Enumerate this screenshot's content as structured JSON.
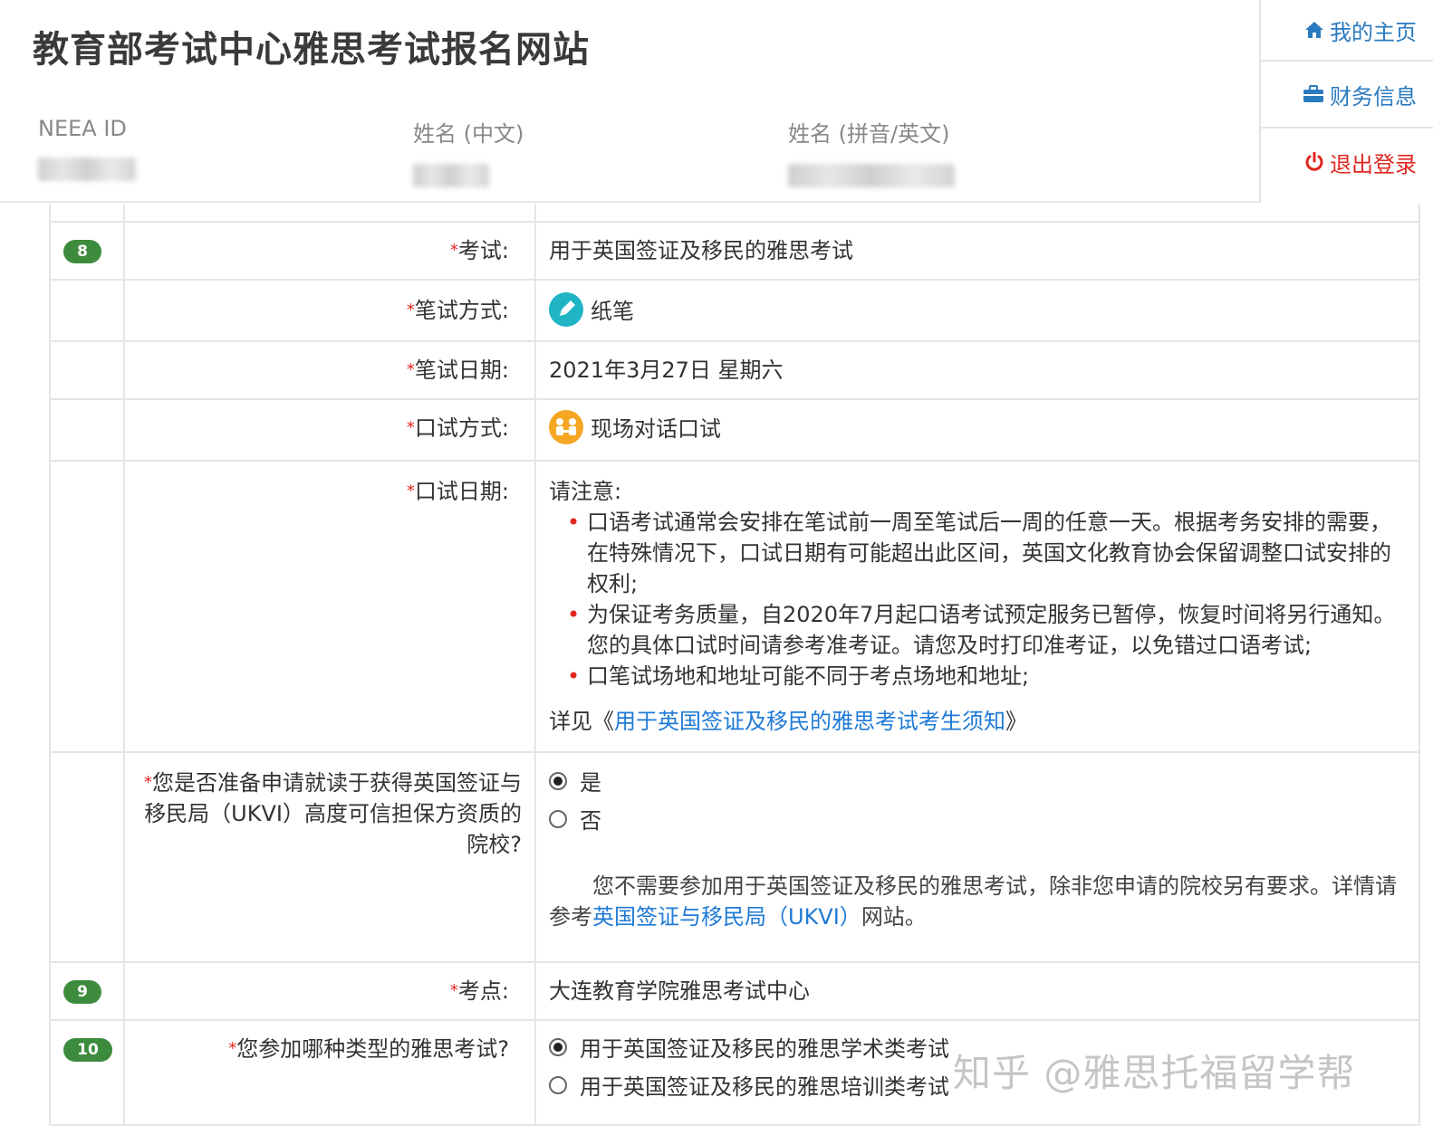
{
  "header": {
    "site_title": "教育部考试中心雅思考试报名网站",
    "fields": [
      {
        "label": "NEEA ID"
      },
      {
        "label": "姓名 (中文)"
      },
      {
        "label": "姓名 (拼音/英文)"
      }
    ]
  },
  "nav": {
    "home": "我的主页",
    "finance": "财务信息",
    "logout": "退出登录"
  },
  "form": {
    "exam": {
      "badge": "8",
      "label": "考试:",
      "value": "用于英国签证及移民的雅思考试"
    },
    "written_mode": {
      "label": "笔试方式:",
      "value": "纸笔"
    },
    "written_date": {
      "label": "笔试日期:",
      "value": "2021年3月27日 星期六"
    },
    "speaking_mode": {
      "label": "口试方式:",
      "value": "现场对话口试"
    },
    "speaking_date": {
      "label": "口试日期:",
      "notice_title": "请注意:",
      "notice_items": [
        "口语考试通常会安排在笔试前一周至笔试后一周的任意一天。根据考务安排的需要，在特殊情况下，口试日期有可能超出此区间，英国文化教育协会保留调整口试安排的权利;",
        "为保证考务质量，自2020年7月起口语考试预定服务已暂停，恢复时间将另行通知。您的具体口试时间请参考准考证。请您及时打印准考证，以免错过口语考试;",
        "口笔试场地和地址可能不同于考点场地和地址;"
      ],
      "details_prefix": "详见《",
      "details_link": "用于英国签证及移民的雅思考试考生须知",
      "details_suffix": "》"
    },
    "ukvi_question": {
      "label": "您是否准备申请就读于获得英国签证与移民局（UKVI）高度可信担保方资质的院校?",
      "options": [
        "是",
        "否"
      ],
      "selected": 0,
      "hint_prefix": "您不需要参加用于英国签证及移民的雅思考试，除非您申请的院校另有要求。详情请参考",
      "hint_link": "英国签证与移民局（UKVI）",
      "hint_suffix": "网站。"
    },
    "center": {
      "badge": "9",
      "label": "考点:",
      "value": "大连教育学院雅思考试中心"
    },
    "test_type": {
      "badge": "10",
      "label": "您参加哪种类型的雅思考试?",
      "options": [
        "用于英国签证及移民的雅思学术类考试",
        "用于英国签证及移民的雅思培训类考试"
      ],
      "selected": 0
    }
  },
  "watermark": "知乎 @雅思托福留学帮",
  "colors": {
    "accent_blue": "#2a7ac0",
    "link_blue": "#1f7ad6",
    "alert_red": "#e0271f",
    "badge_green": "#3d8b3d",
    "paper_teal": "#1fb5c4",
    "speaking_orange": "#f5a623"
  }
}
